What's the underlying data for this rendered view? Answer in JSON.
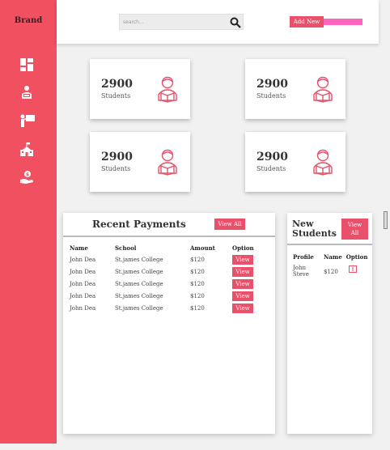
{
  "sidebar": {
    "brand": "Brand",
    "items": [
      {
        "icon": "dashboard-icon"
      },
      {
        "icon": "student-reading-icon"
      },
      {
        "icon": "teacher-board-icon"
      },
      {
        "icon": "school-building-icon"
      },
      {
        "icon": "payment-hand-icon"
      }
    ]
  },
  "header": {
    "search_placeholder": "search...",
    "add_new_label": "Add New"
  },
  "stats": [
    {
      "number": "2900",
      "label": "Students"
    },
    {
      "number": "2900",
      "label": "Students"
    },
    {
      "number": "2900",
      "label": "Students"
    },
    {
      "number": "2900",
      "label": "Students"
    }
  ],
  "payments": {
    "title": "Recent Payments",
    "view_all_label": "View All",
    "columns": [
      "Name",
      "School",
      "Amount",
      "Option"
    ],
    "rows": [
      {
        "name": "John Dea",
        "school": "St.james College",
        "amount": "$120",
        "option": "View"
      },
      {
        "name": "John Dea",
        "school": "St.james College",
        "amount": "$120",
        "option": "View"
      },
      {
        "name": "John Dea",
        "school": "St.james College",
        "amount": "$120",
        "option": "View"
      },
      {
        "name": "John Dea",
        "school": "St.james College",
        "amount": "$120",
        "option": "View"
      },
      {
        "name": "John Dea",
        "school": "St.james College",
        "amount": "$120",
        "option": "View"
      }
    ]
  },
  "new_students": {
    "title_line1": "New",
    "title_line2": "Students",
    "view_all_line1": "View",
    "view_all_line2": "All",
    "columns": [
      "Profile",
      "Name",
      "Option"
    ],
    "rows": [
      {
        "name_line1": "John",
        "name_line2": "Steve",
        "amount": "$120"
      }
    ]
  },
  "colors": {
    "sidebar": "#f0505f",
    "accent": "#e9506a",
    "accent_bar": "#ff66bb"
  }
}
